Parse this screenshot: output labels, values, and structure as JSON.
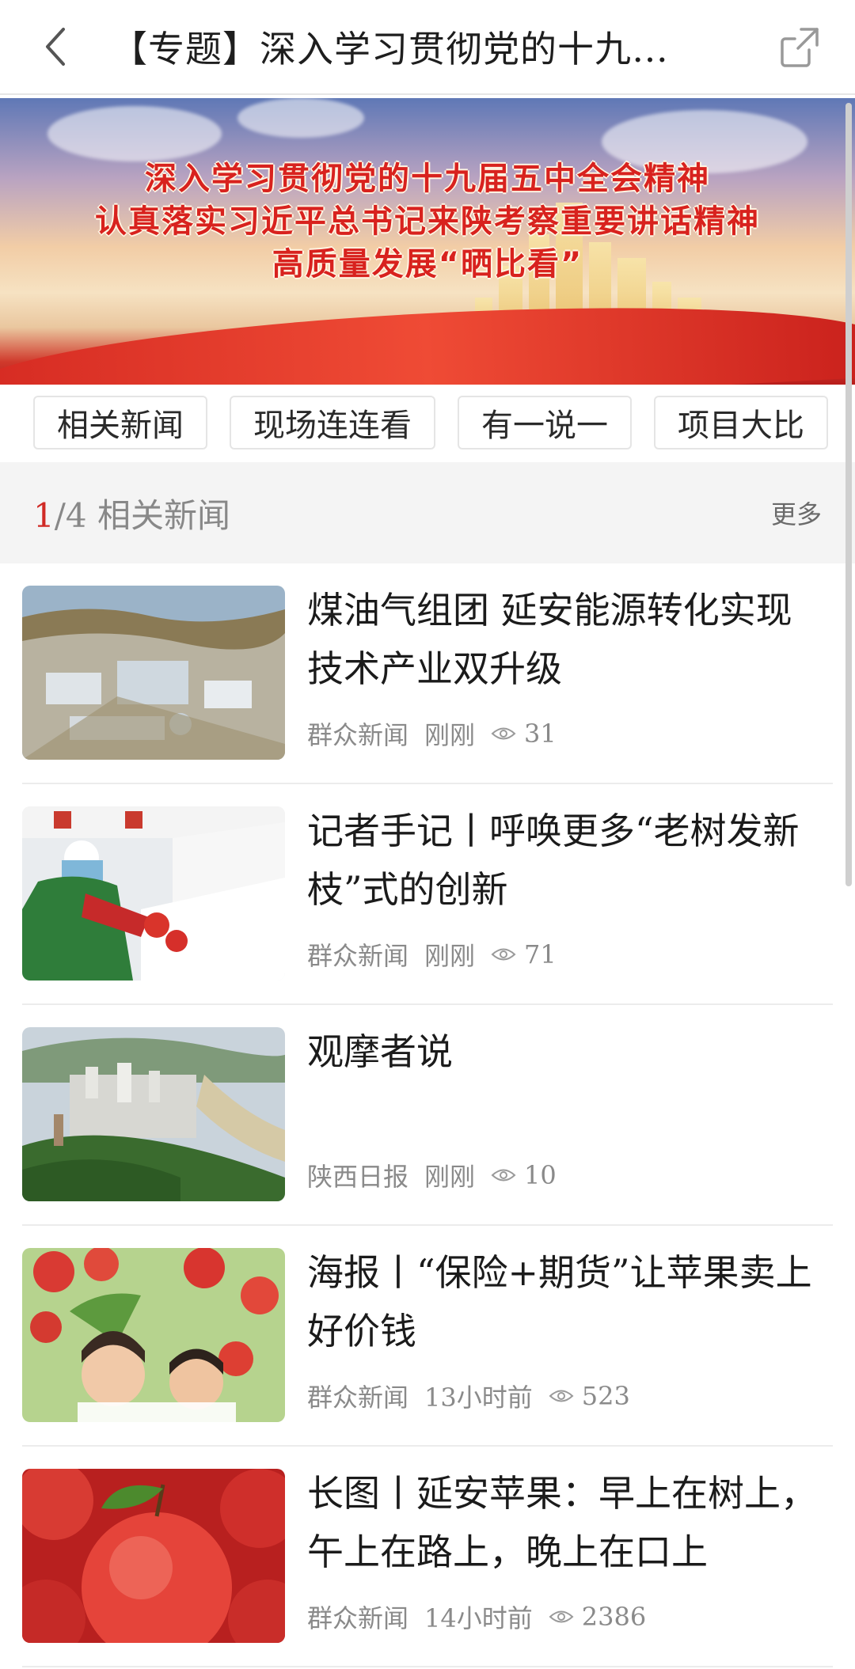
{
  "header": {
    "title": "【专题】深入学习贯彻党的十九…",
    "back_icon": "chevron-left-icon",
    "share_icon": "share-icon"
  },
  "banner": {
    "lines": [
      "深入学习贯彻党的十九届五中全会精神",
      "认真落实习近平总书记来陕考察重要讲话精神",
      "高质量发展“晒比看”"
    ]
  },
  "tabs": [
    "相关新闻",
    "现场连连看",
    "有一说一",
    "项目大比"
  ],
  "section": {
    "index": "1",
    "total": "/4",
    "title": "相关新闻",
    "more": "更多"
  },
  "articles": [
    {
      "title": "煤油气组团 延安能源转化实现技术产业双升级",
      "source": "群众新闻",
      "time": "刚刚",
      "views": "31"
    },
    {
      "title": "记者手记丨呼唤更多“老树发新枝”式的创新",
      "source": "群众新闻",
      "time": "刚刚",
      "views": "71"
    },
    {
      "title": "观摩者说",
      "source": "陕西日报",
      "time": "刚刚",
      "views": "10"
    },
    {
      "title": "海报丨“保险+期货”让苹果卖上好价钱",
      "source": "群众新闻",
      "time": "13小时前",
      "views": "523"
    },
    {
      "title": "长图丨延安苹果：早上在树上，午上在路上，晚上在口上",
      "source": "群众新闻",
      "time": "14小时前",
      "views": "2386"
    }
  ],
  "colors": {
    "accent": "#d02a25",
    "text": "#1b1b1b",
    "muted": "#8a8a8a"
  }
}
